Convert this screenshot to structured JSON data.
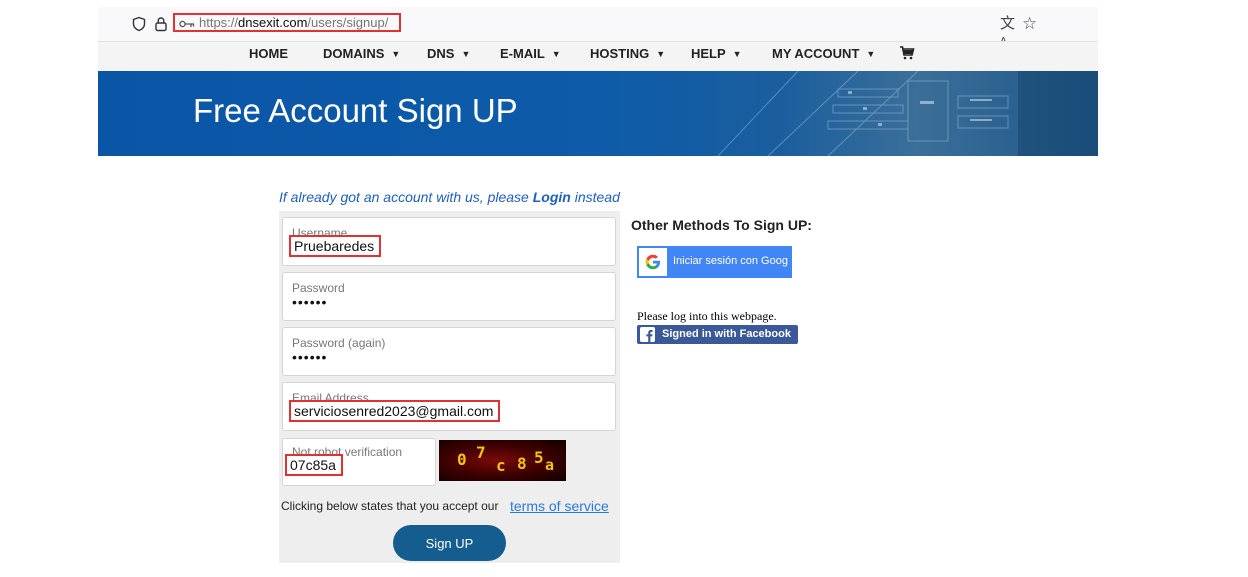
{
  "browser": {
    "url_prefix": "https://",
    "url_domain": "dnsexit.com",
    "url_path": "/users/signup/"
  },
  "nav": {
    "home": "HOME",
    "domains": "DOMAINS",
    "dns": "DNS",
    "email": "E-MAIL",
    "hosting": "HOSTING",
    "help": "HELP",
    "account": "MY ACCOUNT"
  },
  "hero": {
    "title": "Free Account Sign UP"
  },
  "login_hint": {
    "prefix": "If already got an account with us, please ",
    "link": "Login",
    "suffix": " instead"
  },
  "form": {
    "username_label": "Username",
    "username_value": "Pruebaredes",
    "password_label": "Password",
    "password_value": "••••••",
    "password_again_label": "Password (again)",
    "password_again_value": "••••••",
    "email_label": "Email Address",
    "email_value": "serviciosenred2023@gmail.com",
    "captcha_label": "Not robot verification",
    "captcha_value": "07c85a",
    "captcha_chars": [
      "0",
      "7",
      "c",
      "8",
      "5",
      "a"
    ],
    "terms_text": "Clicking below states that you accept our",
    "terms_link": "terms of service",
    "submit": "Sign UP"
  },
  "other_methods": {
    "title": "Other Methods To Sign UP:",
    "google_label": "Iniciar sesión con Goog",
    "fb_note": "Please log into this webpage.",
    "fb_label": "Signed in with Facebook"
  },
  "colors": {
    "hero_blue": "#0b55a6",
    "link_blue": "#2b79d8",
    "button_blue": "#155c8f",
    "highlight_red": "#e03232",
    "google_blue": "#4285f4",
    "facebook_blue": "#3b5998",
    "captcha_text": "#f1c40f"
  }
}
